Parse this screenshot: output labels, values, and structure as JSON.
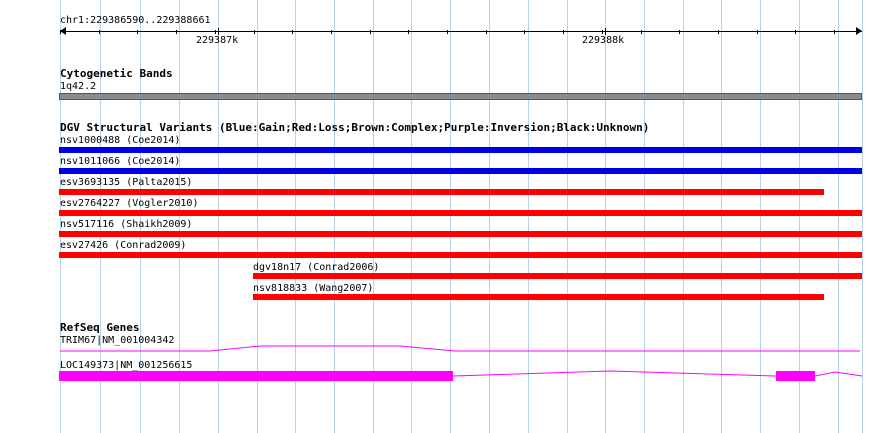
{
  "ruler": {
    "position_label": "chr1:229386590..229388661",
    "major_ticks": [
      {
        "label": "229387k"
      },
      {
        "label": "229388k"
      }
    ]
  },
  "cytogenetic": {
    "title": "Cytogenetic Bands",
    "band_label": "1q42.2",
    "band_color": "#8c8c8c"
  },
  "dgv": {
    "title": "DGV Structural Variants (Blue:Gain;Red:Loss;Brown:Complex;Purple:Inversion;Black:Unknown)",
    "colors": {
      "gain": "#0000e6",
      "loss": "#ff0000"
    },
    "variants": [
      {
        "label": "nsv1000488 (Coe2014)",
        "type": "gain"
      },
      {
        "label": "nsv1011066 (Coe2014)",
        "type": "gain"
      },
      {
        "label": "esv3693135 (Palta2015)",
        "type": "loss"
      },
      {
        "label": "esv2764227 (Vogler2010)",
        "type": "loss"
      },
      {
        "label": "nsv517116 (Shaikh2009)",
        "type": "loss"
      },
      {
        "label": "esv27426 (Conrad2009)",
        "type": "loss"
      },
      {
        "label": "dgv18n17 (Conrad2006)",
        "type": "loss"
      },
      {
        "label": "nsv818833 (Wang2007)",
        "type": "loss"
      }
    ]
  },
  "refseq": {
    "title": "RefSeq Genes",
    "color": "#ff00ff",
    "genes": [
      {
        "label": "TRIM67|NM_001004342"
      },
      {
        "label": "LOC149373|NM_001256615"
      }
    ]
  }
}
